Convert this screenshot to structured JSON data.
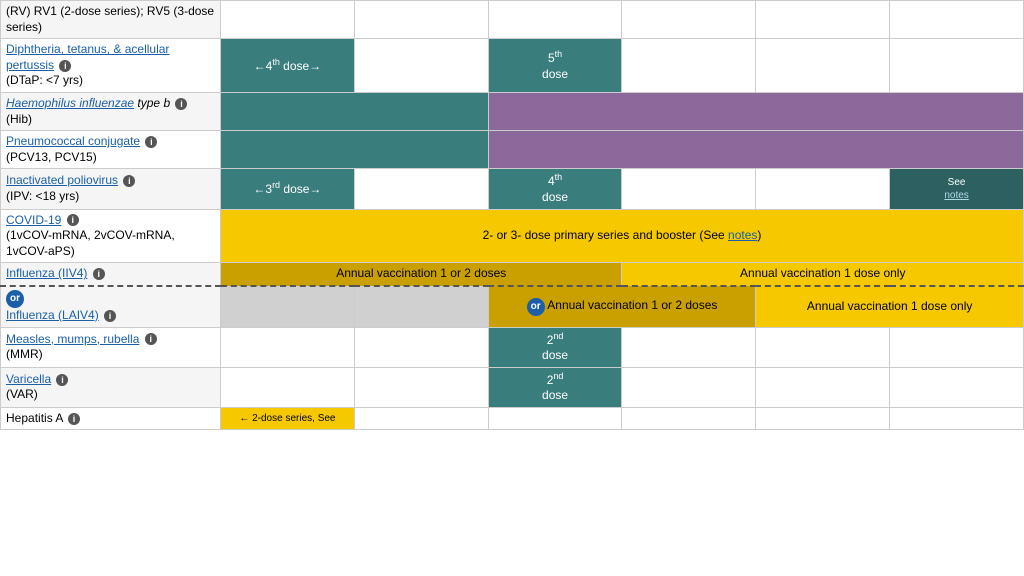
{
  "table": {
    "rows": [
      {
        "id": "rv",
        "name": "RV) RV1 (2-dose series); RV5 (3-dose series)",
        "name_link": false,
        "subname": "",
        "cells": [
          {
            "colspan": 1,
            "rowspan": 1,
            "class": "white-cell",
            "text": ""
          },
          {
            "colspan": 1,
            "rowspan": 1,
            "class": "white-cell",
            "text": ""
          },
          {
            "colspan": 1,
            "rowspan": 1,
            "class": "white-cell",
            "text": ""
          },
          {
            "colspan": 1,
            "rowspan": 1,
            "class": "white-cell",
            "text": ""
          },
          {
            "colspan": 1,
            "rowspan": 1,
            "class": "white-cell",
            "text": ""
          },
          {
            "colspan": 1,
            "rowspan": 1,
            "class": "white-cell",
            "text": ""
          }
        ]
      }
    ]
  },
  "vaccines": [
    {
      "id": "dtap",
      "name": "Diphtheria, tetanus, & acellular pertussis",
      "name_link": true,
      "info_icon": true,
      "subname": "(DTaP: <7 yrs)",
      "row_bg": "row-bg-white",
      "cells": [
        {
          "colspan": 1,
          "class": "teal cell-center",
          "text": "←4th dose→",
          "sup": "th",
          "sup_pos": "4"
        },
        {
          "colspan": 1,
          "class": "white-cell",
          "text": ""
        },
        {
          "colspan": 1,
          "class": "teal cell-center",
          "text": "5th\ndose",
          "sup": "th",
          "sup_pos": "5"
        },
        {
          "colspan": 1,
          "class": "white-cell",
          "text": ""
        },
        {
          "colspan": 1,
          "class": "white-cell",
          "text": ""
        },
        {
          "colspan": 1,
          "class": "white-cell",
          "text": ""
        }
      ]
    },
    {
      "id": "hib",
      "name": "Haemophilus influenzae type b",
      "name_link": true,
      "info_icon": true,
      "subname": "(Hib)",
      "row_bg": "row-bg-light",
      "cells": [
        {
          "colspan": 1,
          "class": "teal",
          "text": ""
        },
        {
          "colspan": 1,
          "class": "teal",
          "text": ""
        },
        {
          "colspan": 4,
          "class": "purple",
          "text": ""
        }
      ]
    },
    {
      "id": "pcv",
      "name": "Pneumococcal conjugate",
      "name_link": true,
      "info_icon": true,
      "subname": "(PCV13, PCV15)",
      "row_bg": "row-bg-white",
      "cells": [
        {
          "colspan": 1,
          "class": "teal",
          "text": ""
        },
        {
          "colspan": 1,
          "class": "teal",
          "text": ""
        },
        {
          "colspan": 4,
          "class": "purple",
          "text": ""
        }
      ]
    },
    {
      "id": "ipv",
      "name": "Inactivated poliovirus",
      "name_link": true,
      "info_icon": true,
      "subname": "(IPV: <18 yrs)",
      "row_bg": "row-bg-light",
      "cells": [
        {
          "colspan": 1,
          "class": "teal cell-center",
          "text": "←3rd dose→",
          "sup": "rd",
          "sup_pos": "3"
        },
        {
          "colspan": 1,
          "class": "white-cell",
          "text": ""
        },
        {
          "colspan": 1,
          "class": "teal cell-center",
          "text": "4th\ndose",
          "sup": "th",
          "sup_pos": "4"
        },
        {
          "colspan": 1,
          "class": "white-cell",
          "text": ""
        },
        {
          "colspan": 1,
          "class": "white-cell",
          "text": ""
        },
        {
          "colspan": 1,
          "class": "teal-dark cell-center small-text",
          "text": "See\nnotes"
        }
      ]
    },
    {
      "id": "covid",
      "name": "COVID-19",
      "name_link": true,
      "info_icon": true,
      "subname": "(1vCOV-mRNA, 2vCOV-mRNA, 1vCOV-aPS)",
      "row_bg": "row-bg-white",
      "cells": [
        {
          "colspan": 6,
          "class": "yellow cell-center",
          "text": "2- or 3- dose primary series and booster (See notes)"
        }
      ]
    },
    {
      "id": "influenza-iiv",
      "name": "Influenza (IIV4)",
      "name_link": true,
      "info_icon": true,
      "subname": "",
      "row_bg": "row-bg-light",
      "dashed_bottom": true,
      "cells": [
        {
          "colspan": 3,
          "class": "yellow-dark cell-center",
          "text": "Annual vaccination 1 or 2 doses"
        },
        {
          "colspan": 3,
          "class": "yellow cell-center",
          "text": "Annual vaccination 1 dose only"
        }
      ]
    },
    {
      "id": "influenza-laiv",
      "name": "Influenza (LAIV4)",
      "name_link": true,
      "info_icon": true,
      "subname": "",
      "or_prefix": true,
      "row_bg": "row-bg-light",
      "dashed_top": true,
      "cells": [
        {
          "colspan": 1,
          "class": "gray-light",
          "text": ""
        },
        {
          "colspan": 1,
          "class": "gray-light",
          "text": ""
        },
        {
          "colspan": 2,
          "class": "yellow-dark cell-center",
          "text": "Annual vaccination 1 or 2 doses",
          "or_badge": true
        },
        {
          "colspan": 2,
          "class": "yellow cell-center",
          "text": "Annual vaccination 1 dose only"
        }
      ]
    },
    {
      "id": "mmr",
      "name": "Measles, mumps, rubella",
      "name_link": true,
      "info_icon": true,
      "subname": "(MMR)",
      "row_bg": "row-bg-white",
      "cells": [
        {
          "colspan": 1,
          "class": "white-cell",
          "text": ""
        },
        {
          "colspan": 1,
          "class": "white-cell",
          "text": ""
        },
        {
          "colspan": 1,
          "class": "teal cell-center",
          "text": "2nd\ndose"
        },
        {
          "colspan": 1,
          "class": "white-cell",
          "text": ""
        },
        {
          "colspan": 1,
          "class": "white-cell",
          "text": ""
        },
        {
          "colspan": 1,
          "class": "white-cell",
          "text": ""
        }
      ]
    },
    {
      "id": "varicella",
      "name": "Varicella",
      "name_link": true,
      "info_icon": true,
      "subname": "(VAR)",
      "row_bg": "row-bg-light",
      "cells": [
        {
          "colspan": 1,
          "class": "white-cell",
          "text": ""
        },
        {
          "colspan": 1,
          "class": "white-cell",
          "text": ""
        },
        {
          "colspan": 1,
          "class": "teal cell-center",
          "text": "2nd\ndose"
        },
        {
          "colspan": 1,
          "class": "white-cell",
          "text": ""
        },
        {
          "colspan": 1,
          "class": "white-cell",
          "text": ""
        },
        {
          "colspan": 1,
          "class": "white-cell",
          "text": ""
        }
      ]
    },
    {
      "id": "hepa",
      "name": "Hepatitis A",
      "name_link": false,
      "info_icon": true,
      "subname": "",
      "row_bg": "row-bg-white",
      "cells": [
        {
          "colspan": 1,
          "class": "yellow cell-center small-text",
          "text": "← 2-dose series, See"
        },
        {
          "colspan": 1,
          "class": "white-cell",
          "text": ""
        },
        {
          "colspan": 1,
          "class": "white-cell",
          "text": ""
        },
        {
          "colspan": 1,
          "class": "white-cell",
          "text": ""
        },
        {
          "colspan": 1,
          "class": "white-cell",
          "text": ""
        },
        {
          "colspan": 1,
          "class": "white-cell",
          "text": ""
        }
      ]
    }
  ],
  "header_row_text": "(RV) RV1 (2-dose series); RV5 (3-dose series)"
}
